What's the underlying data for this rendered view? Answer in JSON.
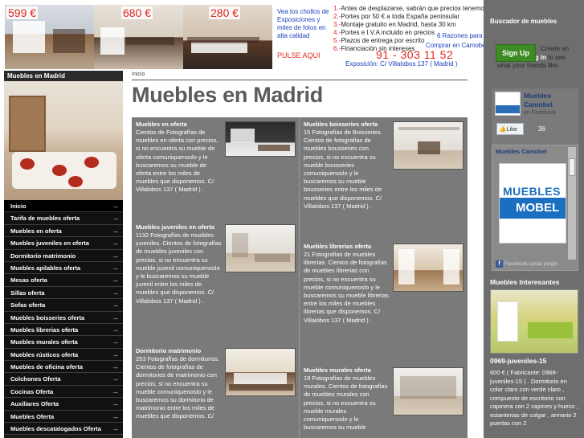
{
  "banner": {
    "prices": [
      "599 €",
      "680 €",
      "280 €"
    ],
    "exhibit_text": "Vea los chollos de Exposiciones y miles de fotos en alta calidad",
    "cta": "PULSE AQUI",
    "list": [
      {
        "num": "1.-",
        "text": "Antes de desplazarse, sabrán que precios tenemos"
      },
      {
        "num": "2.-",
        "text": "Portes por 50 € a toda España peninsular"
      },
      {
        "num": "3.-",
        "text": "Montaje gratuito en Madrid, hasta 30 km"
      },
      {
        "num": "4.-",
        "text": "Portes e I.V.A incluido en precios"
      },
      {
        "num": "5.-",
        "text": "Plazos de entrega por escrito"
      },
      {
        "num": "6.-",
        "text": "Financiación sin intereses"
      }
    ],
    "razones": "6 Razones para",
    "comprar": "Comprar en Camobel",
    "phone": "91 - 303 11 52",
    "exposicion": "Exposición: C/ Villalobos 137 ( Madrid )"
  },
  "left": {
    "title": "Muebles en Madrid",
    "menu": [
      "Inicio",
      "Tarifa de muebles oferta",
      "Muebles en oferta",
      "Muebles juveniles en oferta",
      "Dormitorio matrimonio",
      "Muebles apilables oferta",
      "Mesas oferta",
      "Sillas oferta",
      "Sofas oferta",
      "Muebles boisseries oferta",
      "Muebles librerias oferta",
      "Muebles murales oferta",
      "Muebles rústicos oferta",
      "Muebles de oficina oferta",
      "Colchones Oferta",
      "Cocinas Oferta",
      "Auxiliares Oferta",
      "Muebles Oferta",
      "Muebles descatalogados Oferta"
    ],
    "arrow": "→"
  },
  "main": {
    "breadcrumb": "Inicio",
    "title": "Muebles en Madrid",
    "left_cards": [
      {
        "title": "Muebles en oferta",
        "desc": "Cientos de Fotografías de muebles en oferta con precios, si no encuentra su mueble de oferta comuniquenoslo y le buscaremos su mueble de oferta entre los miles de muebles que disponemos. C/ Villalobos 137 ( Madrid ) ."
      },
      {
        "title": "Muebles juveniles en oferta",
        "desc": "1132 Fotografías de muebles juveniles. Cientos de fotografías de muebles juveniles con precios, si no encuentra su mueble juvenil comuniquenoslo y le buscaremos su mueble juvenil entre los miles de muebles que disponemos. C/ Villalobos 137 ( Madrid ) ."
      },
      {
        "title": "Dormitorio matrimonio",
        "desc": "253 Fotografías de dormitorios. Cientos de fotografías de dormitorios de matrimonio con precios, si no encuentra su mueble comuniquenoslo y le buscaremos su dormitorio de matrimonio entre los miles de muebles que disponemos. C/"
      }
    ],
    "right_cards": [
      {
        "title": "Muebles boisseries oferta",
        "desc": "15 Fotografías de Boisseries. Cientos de fotografías de muebles bousseries con precios, si no encuentra su mueble bousseries comuniquenoslo y le buscaremos su mueble bousseries entre los miles de muebles que disponemos. C/ Villalobos 137 ( Madrid ) ."
      },
      {
        "title": "Muebles librerias oferta",
        "desc": "21 Fotografías de muebles librerias. Cientos de fotografías de muebles librerias con precios, si no encuentra su mueble comuniquenoslo y le buscaremos su mueble librerias entre los miles de muebles librerias que disponemos. C/ Villalobos 137 ( Madrid ) ."
      },
      {
        "title": "Muebles murales oferta",
        "desc": "19 Fotografías de muebles murales. Cientos de fotografías de muebles murales con precios, si no encuentra su mueble murales comuniquenoslo y le buscaremos su mueble"
      }
    ]
  },
  "right": {
    "title": "Buscador de muebles",
    "signup": "Sign Up",
    "login_prefix": "Create an account or",
    "login_link": "log in",
    "login_suffix": "to see what your friends like.",
    "fb_name": "Muebles Camobel",
    "fb_sub": "en Facebook",
    "like": "Like",
    "like_count": "36",
    "widget_title": "Muebles Camobel",
    "logo_top": "MUEBLES",
    "logo_bottom": "MOBEL",
    "widget_foot": "Facebook social plugin",
    "interes_title": "Muebles Interesantes",
    "interes_name": "0969-juveniles-15",
    "interes_desc": "600 € ( Fabricante: 0969-juveniles-15 ) . Dormitorio en color claro con verde claro , compuesto de escritorio con cajonera con 2 cajones y hueco , estanterias de colgar , armario 2 puertas con 2"
  },
  "colors": {
    "accent_red": "#e2261d",
    "link_blue": "#1a3fbf",
    "menu_bg": "#111111",
    "grid_bg": "#7a7a7a",
    "sidebar_bg": "#6e6e6e",
    "signup_green": "#3d8b24"
  }
}
